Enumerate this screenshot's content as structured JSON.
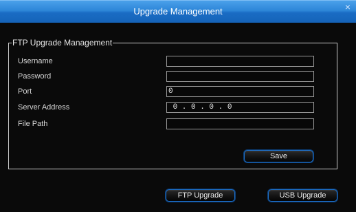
{
  "window": {
    "title": "Upgrade Management",
    "close_glyph": "×"
  },
  "ftp_section": {
    "legend": "FTP Upgrade Management",
    "fields": [
      {
        "label": "Username",
        "value": ""
      },
      {
        "label": "Password",
        "value": ""
      },
      {
        "label": "Port",
        "value": "0"
      },
      {
        "label": "Server Address",
        "value": " 0 . 0 . 0 . 0"
      },
      {
        "label": "File Path",
        "value": ""
      }
    ],
    "save_label": "Save"
  },
  "footer": {
    "ftp_upgrade_label": "FTP Upgrade",
    "usb_upgrade_label": "USB Upgrade"
  },
  "colors": {
    "title_bar": "#2d86d8",
    "button_border": "#1d6fc8",
    "background": "#040404"
  }
}
